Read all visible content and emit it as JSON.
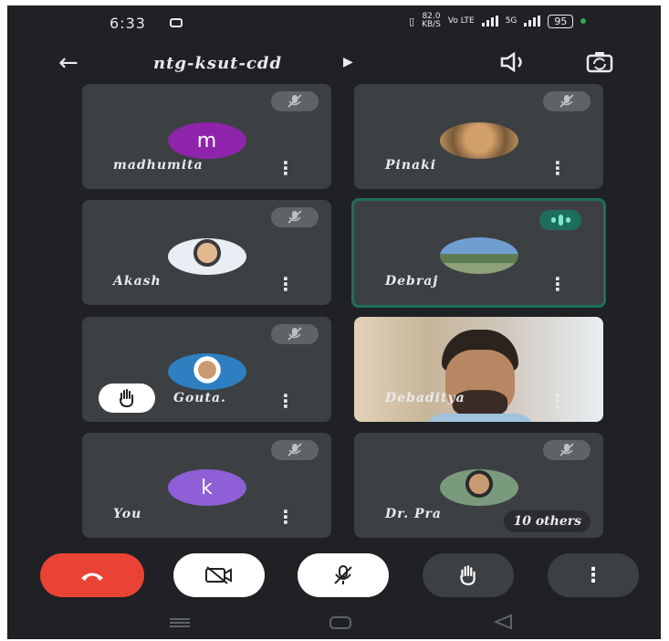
{
  "status_bar": {
    "time": "6:33",
    "speed_value": "82.0",
    "speed_unit": "KB/S",
    "network_1": "Vo LTE",
    "network_2": "5G",
    "battery": "95"
  },
  "header": {
    "meeting_code": "ntg-ksut-cdd"
  },
  "participants": [
    {
      "name": "madhumita",
      "avatar_letter": "m",
      "avatar_color": "#8e24aa",
      "muted": true
    },
    {
      "name": "Pinaki",
      "avatar_letter": "",
      "avatar_color": "#b8864b",
      "muted": true
    },
    {
      "name": "Akash",
      "avatar_letter": "",
      "avatar_color": "#c9d3dc",
      "muted": true
    },
    {
      "name": "Debraj",
      "avatar_letter": "",
      "avatar_color": "#6a8aa0",
      "muted": false,
      "speaking": true
    },
    {
      "name": "Gouta.",
      "avatar_letter": "",
      "avatar_color": "#2e7fc1",
      "muted": true,
      "hand_raised": true
    },
    {
      "name": "Debaditya",
      "avatar_letter": "",
      "avatar_color": "#d8c9b4",
      "muted": false,
      "video_on": true
    },
    {
      "name": "You",
      "avatar_letter": "k",
      "avatar_color": "#8e5fd6",
      "muted": true
    },
    {
      "name": "Dr. Pra",
      "avatar_letter": "",
      "avatar_color": "#7a9a7e",
      "muted": true
    }
  ],
  "others_badge": "10 others",
  "controls": {
    "end_call_color": "#ea4335",
    "camera_off": true,
    "mic_off": true
  },
  "colors": {
    "background": "#202124",
    "tile": "#3c4043",
    "active_border": "#1e6e5e"
  }
}
